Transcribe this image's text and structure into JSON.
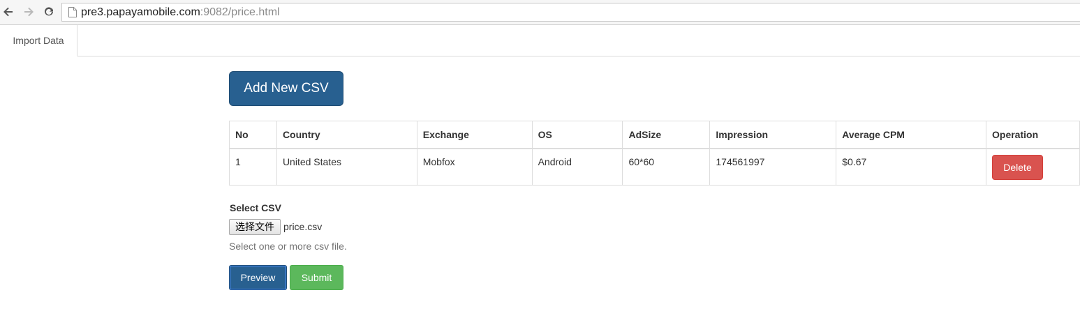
{
  "browser": {
    "url_host": "pre3.papayamobile.com",
    "url_rest": ":9082/price.html",
    "icons": [
      "back-arrow-icon",
      "forward-arrow-icon",
      "reload-icon",
      "page-icon"
    ]
  },
  "tabs": [
    {
      "label": "Import Data",
      "active": true
    }
  ],
  "main": {
    "add_button_label": "Add New CSV",
    "table": {
      "columns": [
        "No",
        "Country",
        "Exchange",
        "OS",
        "AdSize",
        "Impression",
        "Average CPM",
        "Operation"
      ],
      "rows": [
        {
          "no": "1",
          "country": "United States",
          "exchange": "Mobfox",
          "os": "Android",
          "adsize": "60*60",
          "impression": "174561997",
          "average_cpm": "$0.67",
          "operation_label": "Delete"
        }
      ]
    },
    "form": {
      "select_label": "Select CSV",
      "file_button_label": "选择文件",
      "file_name": "price.csv",
      "help_text": "Select one or more csv file.",
      "preview_label": "Preview",
      "submit_label": "Submit"
    }
  },
  "colors": {
    "primary": "#286090",
    "success": "#5cb85c",
    "danger": "#d9534f"
  }
}
